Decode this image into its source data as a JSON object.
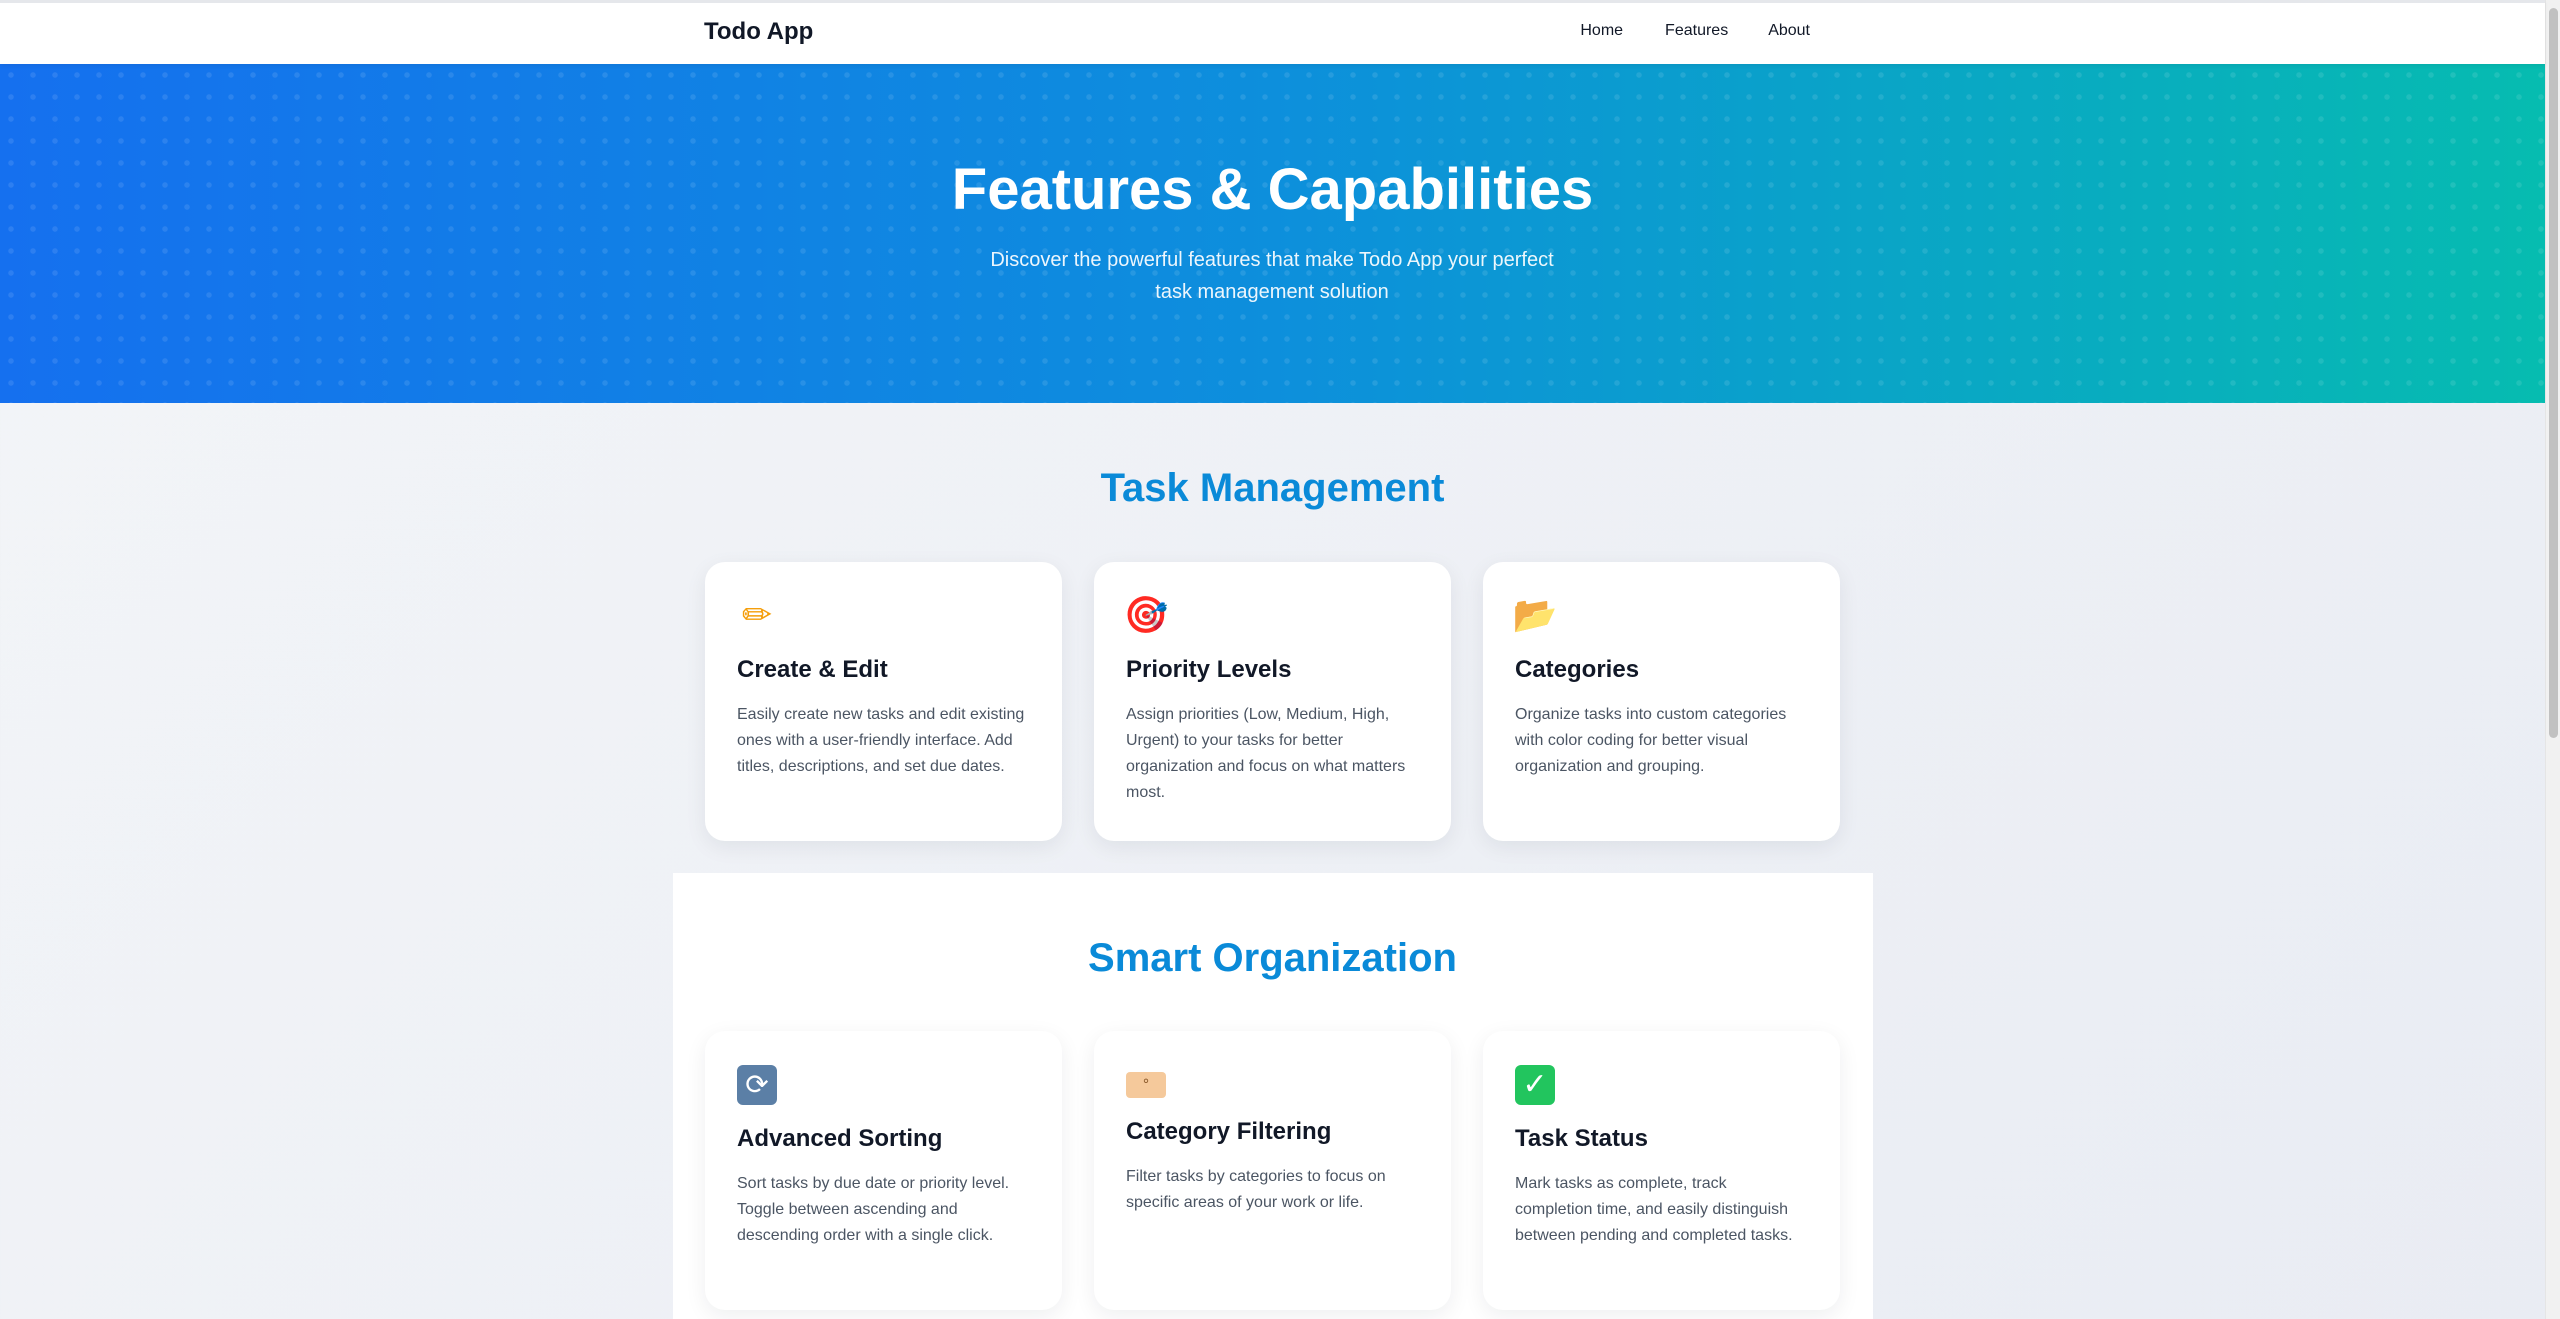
{
  "navbar": {
    "brand": "Todo App",
    "links": [
      "Home",
      "Features",
      "About"
    ]
  },
  "hero": {
    "title": "Features & Capabilities",
    "subtitle": "Discover the powerful features that make Todo App your perfect task management solution"
  },
  "sections": [
    {
      "title": "Task Management",
      "cards": [
        {
          "icon": "pencil-icon",
          "glyph": "✏",
          "title": "Create & Edit",
          "description": "Easily create new tasks and edit existing ones with a user-friendly interface. Add titles, descriptions, and set due dates."
        },
        {
          "icon": "target-icon",
          "glyph": "🎯",
          "title": "Priority Levels",
          "description": "Assign priorities (Low, Medium, High, Urgent) to your tasks for better organization and focus on what matters most."
        },
        {
          "icon": "folder-icon",
          "glyph": "📂",
          "title": "Categories",
          "description": "Organize tasks into custom categories with color coding for better visual organization and grouping."
        }
      ]
    },
    {
      "title": "Smart Organization",
      "cards": [
        {
          "icon": "sort-icon",
          "glyph": "⟳",
          "title": "Advanced Sorting",
          "description": "Sort tasks by due date or priority level. Toggle between ascending and descending order with a single click."
        },
        {
          "icon": "tag-icon",
          "glyph": "°",
          "title": "Category Filtering",
          "description": "Filter tasks by categories to focus on specific areas of your work or life."
        },
        {
          "icon": "checkmark-icon",
          "glyph": "✓",
          "title": "Task Status",
          "description": "Mark tasks as complete, track completion time, and easily distinguish between pending and completed tasks."
        }
      ]
    }
  ]
}
